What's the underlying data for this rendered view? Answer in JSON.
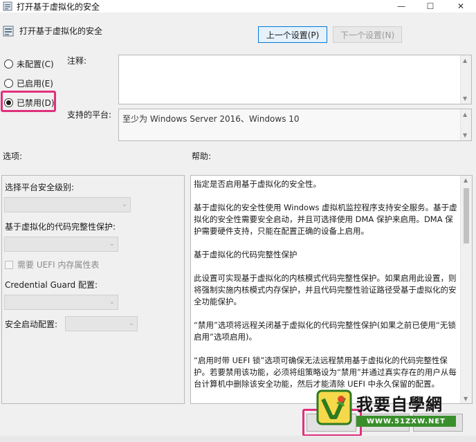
{
  "window": {
    "title": "打开基于虚拟化的安全",
    "controls": {
      "minimize": "—",
      "maximize": "☐",
      "close": "✕"
    }
  },
  "header": {
    "title": "打开基于虚拟化的安全",
    "prev_button": "上一个设置(P)",
    "next_button": "下一个设置(N)"
  },
  "state_options": [
    {
      "label": "未配置(C)",
      "checked": false
    },
    {
      "label": "已启用(E)",
      "checked": false
    },
    {
      "label": "已禁用(D)",
      "checked": true
    }
  ],
  "comment": {
    "label": "注释:",
    "value": ""
  },
  "platform": {
    "label": "支持的平台:",
    "value": "至少为 Windows Server 2016、Windows 10"
  },
  "sections": {
    "options_label": "选项:",
    "help_label": "帮助:"
  },
  "options": {
    "platform_security_level_label": "选择平台安全级别:",
    "code_integrity_label": "基于虚拟化的代码完整性保护:",
    "uefi_memory_label": "需要 UEFI 内存属性表",
    "credential_guard_label": "Credential Guard 配置:",
    "secure_launch_label": "安全启动配置:"
  },
  "help": {
    "paragraphs": [
      "指定是否启用基于虚拟化的安全性。",
      "基于虚拟化的安全性使用 Windows 虚拟机监控程序支持安全服务。基于虚拟化的安全性需要安全启动，并且可选择使用 DMA 保护来启用。DMA 保护需要硬件支持，只能在配置正确的设备上启用。",
      "基于虚拟化的代码完整性保护",
      "此设置可实现基于虚拟化的内核模式代码完整性保护。如果启用此设置，则将强制实施内核模式内存保护，并且代码完整性验证路径受基于虚拟化的安全功能保护。",
      "“禁用”选项将远程关闭基于虚拟化的代码完整性保护(如果之前已使用“无锁启用”选项启用)。",
      "“启用时带 UEFI 锁”选项可确保无法远程禁用基于虚拟化的代码完整性保护。若要禁用该功能，必须将组策略设为“禁用”并通过真实存在的用户从每台计算机中删除该安全功能，然后才能清除 UEFI 中永久保留的配置。"
    ]
  },
  "watermark": {
    "title": "我要自學網",
    "url": "WWW.51ZXW.NET"
  },
  "colors": {
    "highlight": "#e0307c",
    "accent": "#0078d7",
    "watermark_green": "#3a8f2c"
  }
}
